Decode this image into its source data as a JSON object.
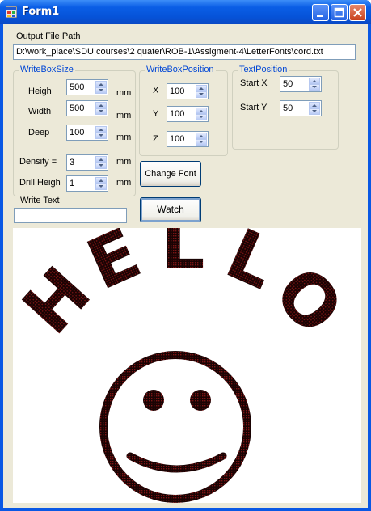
{
  "window": {
    "title": "Form1"
  },
  "output": {
    "label": "Output File Path",
    "path": "D:\\work_place\\SDU courses\\2 quater\\ROB-1\\Assigment-4\\LetterFonts\\cord.txt"
  },
  "write_box_size": {
    "title": "WriteBoxSize",
    "heigh": {
      "label": "Heigh",
      "value": "500",
      "unit": "mm"
    },
    "width": {
      "label": "Width",
      "value": "500",
      "unit": "mm"
    },
    "deep": {
      "label": "Deep",
      "value": "100",
      "unit": "mm"
    },
    "density": {
      "label": "Density =",
      "value": "3",
      "unit": "mm"
    },
    "drill_heigh": {
      "label": "Drill Heigh",
      "value": "1",
      "unit": "mm"
    }
  },
  "write_box_position": {
    "title": "WriteBoxPosition",
    "x": {
      "label": "X",
      "value": "100"
    },
    "y": {
      "label": "Y",
      "value": "100"
    },
    "z": {
      "label": "Z",
      "value": "100"
    }
  },
  "text_position": {
    "title": "TextPosition",
    "start_x": {
      "label": "Start X",
      "value": "50"
    },
    "start_y": {
      "label": "Start Y",
      "value": "50"
    }
  },
  "buttons": {
    "change_font": "Change Font",
    "watch": "Watch"
  },
  "write_text": {
    "label": "Write Text",
    "value": ""
  },
  "drawing": {
    "text": "HELLO",
    "fill_color": "#2a0606"
  },
  "colors": {
    "titlebar": "#0A5EE6",
    "client_bg": "#ECE9D8",
    "group_title": "#0046D5"
  }
}
